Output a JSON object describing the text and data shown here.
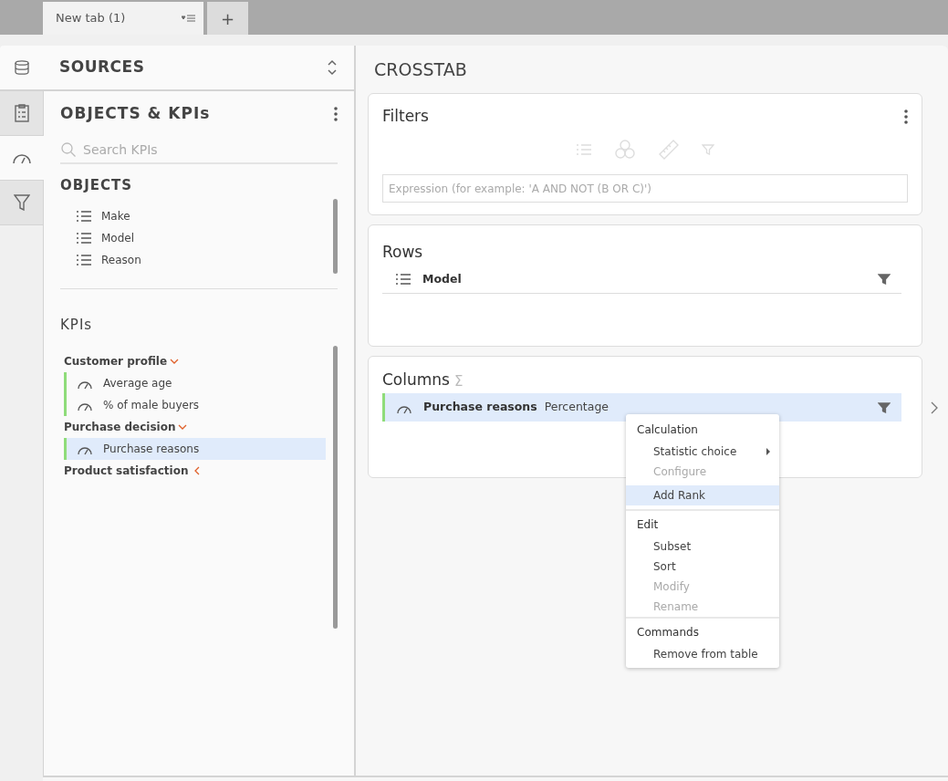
{
  "tabs": [
    {
      "label": "New tab (1)",
      "selected": true
    }
  ],
  "add_tab": "+",
  "rail": [
    {
      "kind": "clipboard",
      "selected": false
    },
    {
      "kind": "gauge",
      "selected": true
    },
    {
      "kind": "filter",
      "selected": false
    }
  ],
  "sources": {
    "title": "SOURCES"
  },
  "objects_kpis": {
    "title": "OBJECTS & KPIs",
    "search": {
      "placeholder": "Search KPIs"
    },
    "objects": {
      "title": "OBJECTS",
      "items": [
        "Make",
        "Model",
        "Reason"
      ]
    },
    "kpis": {
      "title": "KPIs",
      "groups": [
        {
          "label": "Customer profile",
          "expanded": true,
          "items": [
            {
              "label": "Average age",
              "selected": false
            },
            {
              "label": "% of male buyers",
              "selected": false
            }
          ]
        },
        {
          "label": "Purchase decision",
          "expanded": true,
          "items": [
            {
              "label": "Purchase reasons",
              "selected": true
            }
          ]
        },
        {
          "label": "Product satisfaction",
          "expanded": false
        }
      ]
    }
  },
  "crosstab": {
    "title": "CROSSTAB",
    "filters": {
      "title": "Filters",
      "placeholder": "Expression (for example: 'A AND NOT (B OR C)')"
    },
    "rows": {
      "title": "Rows",
      "items": [
        {
          "label": "Model",
          "selected": false
        }
      ]
    },
    "columns": {
      "title": "Columns",
      "sigma": "Σ",
      "items": [
        {
          "label": "Purchase reasons",
          "statistic": "Percentage",
          "selected": true
        }
      ]
    }
  },
  "context_menu": {
    "sections": [
      {
        "title": "Calculation",
        "items": [
          {
            "label": "Statistic choice",
            "disabled": false,
            "selected": false,
            "submenu": true
          },
          {
            "label": "Configure",
            "disabled": true,
            "selected": false,
            "submenu": false
          },
          {
            "label": "Add Rank",
            "disabled": false,
            "selected": true,
            "submenu": false
          }
        ]
      },
      {
        "title": "Edit",
        "items": [
          {
            "label": "Subset",
            "disabled": false,
            "selected": false,
            "submenu": false
          },
          {
            "label": "Sort",
            "disabled": false,
            "selected": false,
            "submenu": false
          },
          {
            "label": "Modify",
            "disabled": true,
            "selected": false,
            "submenu": false
          },
          {
            "label": "Rename",
            "disabled": true,
            "selected": false,
            "submenu": false
          }
        ]
      },
      {
        "title": "Commands",
        "items": [
          {
            "label": "Remove from table",
            "disabled": false,
            "selected": false,
            "submenu": false
          }
        ]
      }
    ]
  }
}
